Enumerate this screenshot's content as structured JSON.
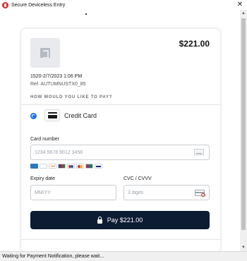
{
  "window": {
    "title": "Secure Deviceless Entry",
    "close_glyph": "✕"
  },
  "payment": {
    "amount": "$221.00",
    "order_info": "1520-2/7/2023 1:06 PM",
    "reference": "Ref. AUTUMNUSTX0_85",
    "section_heading": "HOW WOULD YOU LIKE TO PAY?",
    "method_label": "Credit Card",
    "method_selected": true
  },
  "fields": {
    "card_number": {
      "label": "Card number",
      "placeholder": "1234 5678 9012 3456",
      "value": ""
    },
    "expiry": {
      "label": "Expiry date",
      "placeholder": "MM/YY",
      "value": ""
    },
    "cvc": {
      "label": "CVC / CVVV",
      "placeholder": "3 digits",
      "value": ""
    }
  },
  "card_brands": [
    "amex-icon",
    "diners-icon",
    "discover-icon",
    "jcb-icon",
    "maestro-icon",
    "mastercard-icon",
    "unionpay-icon",
    "visa-icon"
  ],
  "pay_button": {
    "label": "Pay $221.00",
    "color": "#0d1b33"
  },
  "scrollbar": {
    "up_glyph": "▲",
    "down_glyph": "▼"
  },
  "status": {
    "text": "Waiting for Payment Notification, please wait..."
  },
  "colors": {
    "accent": "#1a73e8",
    "close_icon": "#d32f2f"
  }
}
